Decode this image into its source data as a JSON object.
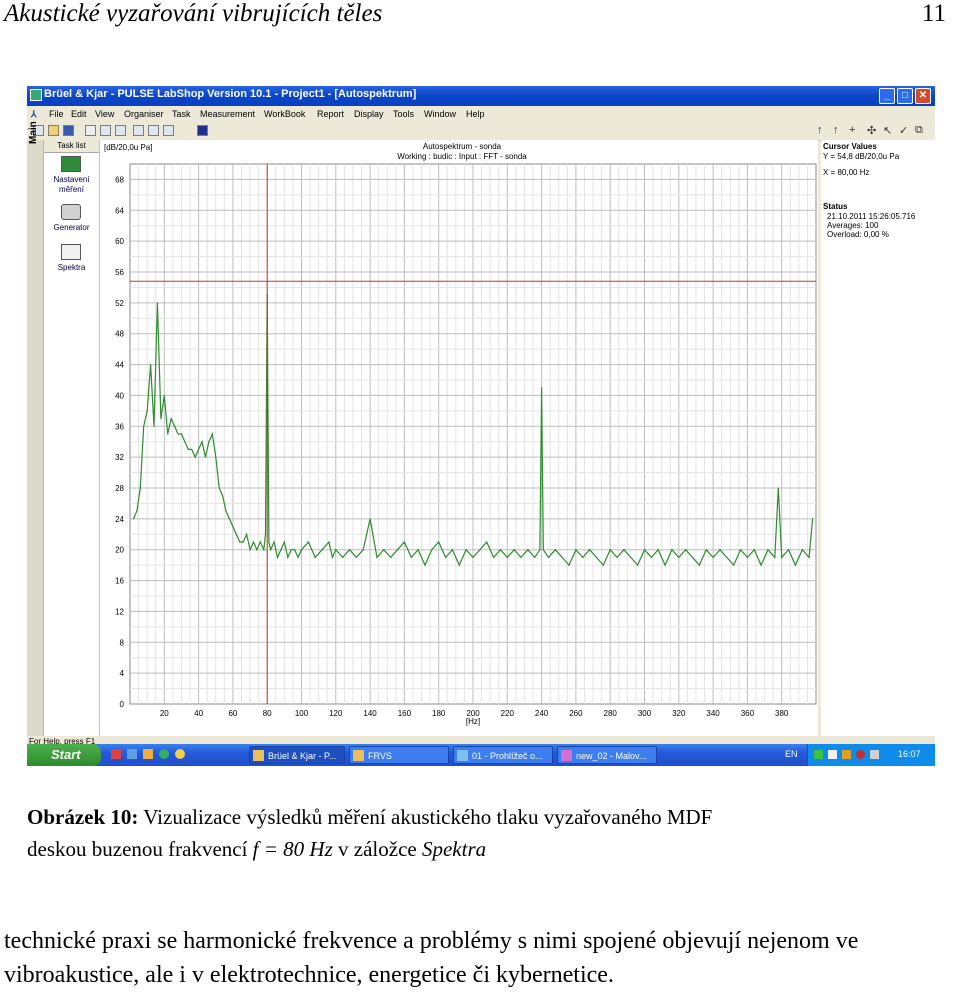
{
  "page": {
    "header_title": "Akustické vyzařování vibrujících těles",
    "page_number": "11"
  },
  "window": {
    "title": "Brüel & Kjar - PULSE LabShop Version 10.1 - Project1 - [Autospektrum]",
    "buttons": [
      "_",
      "□",
      "✕"
    ]
  },
  "menu": [
    "File",
    "Edit",
    "View",
    "Organiser",
    "Task",
    "Measurement",
    "WorkBook",
    "Report",
    "Display",
    "Tools",
    "Window",
    "Help"
  ],
  "sidebar": {
    "main_label": "Main",
    "task_list_header": "Task list",
    "items": [
      {
        "label_line1": "Nastavení",
        "label_line2": "měření"
      },
      {
        "label_line1": "Generator",
        "label_line2": ""
      },
      {
        "label_line1": "Spektra",
        "label_line2": ""
      }
    ]
  },
  "chart_header": {
    "unit_label": "[dB/20,0u Pa]",
    "title_line1": "Autospektrum - sonda",
    "title_line2": "Working : budic : Input : FFT - sonda"
  },
  "cursor_values": {
    "header": "Cursor Values",
    "y": "Y = 54,8 dB/20,0u Pa",
    "x": "X = 80,00 Hz",
    "status_header": "Status",
    "timestamp": "21.10.2011  15:26:05.716",
    "averages": "Averages: 100",
    "overload": "Overload:  0,00 %"
  },
  "chart_data": {
    "type": "line",
    "xlabel": "[Hz]",
    "ylabel": "[dB/20,0u Pa]",
    "xlim": [
      0,
      400
    ],
    "ylim": [
      0,
      70
    ],
    "x_ticks": [
      20,
      40,
      60,
      80,
      100,
      120,
      140,
      160,
      180,
      200,
      220,
      240,
      260,
      280,
      300,
      320,
      340,
      360,
      380
    ],
    "y_ticks": [
      0,
      4,
      8,
      12,
      16,
      20,
      24,
      28,
      32,
      36,
      40,
      44,
      48,
      52,
      56,
      60,
      64,
      68
    ],
    "grid": true,
    "cursor": {
      "x": 80,
      "y": 54.8
    },
    "series": [
      {
        "color": "#2e8b2e",
        "x": [
          2,
          4,
          6,
          8,
          10,
          12,
          14,
          16,
          18,
          20,
          22,
          24,
          26,
          28,
          30,
          32,
          34,
          36,
          38,
          40,
          42,
          44,
          46,
          48,
          50,
          52,
          54,
          56,
          58,
          60,
          62,
          64,
          66,
          68,
          70,
          72,
          74,
          76,
          78,
          79,
          80,
          81,
          82,
          84,
          86,
          88,
          90,
          92,
          94,
          96,
          98,
          100,
          104,
          108,
          112,
          116,
          118,
          120,
          124,
          128,
          132,
          136,
          140,
          144,
          148,
          152,
          156,
          160,
          164,
          168,
          172,
          176,
          180,
          184,
          188,
          192,
          196,
          200,
          204,
          208,
          212,
          216,
          220,
          224,
          228,
          232,
          236,
          239,
          240,
          241,
          244,
          248,
          252,
          256,
          260,
          264,
          268,
          272,
          276,
          280,
          284,
          288,
          292,
          296,
          300,
          304,
          308,
          312,
          316,
          320,
          324,
          328,
          332,
          336,
          340,
          344,
          348,
          352,
          356,
          360,
          364,
          368,
          372,
          376,
          378,
          380,
          384,
          388,
          392,
          396,
          398
        ],
        "y": [
          24,
          25,
          28,
          36,
          38,
          44,
          36,
          52,
          37,
          40,
          35,
          37,
          36,
          35,
          35,
          34,
          33,
          33,
          32,
          33,
          34,
          32,
          34,
          35,
          32,
          28,
          27,
          25,
          24,
          23,
          22,
          21,
          21,
          22,
          20,
          21,
          20,
          21,
          20,
          22,
          53,
          21,
          20,
          21,
          19,
          20,
          21,
          19,
          20,
          20,
          19,
          20,
          21,
          19,
          20,
          21,
          19,
          20,
          19,
          20,
          19,
          20,
          24,
          19,
          20,
          19,
          20,
          21,
          19,
          20,
          18,
          20,
          21,
          19,
          20,
          18,
          20,
          19,
          20,
          21,
          19,
          20,
          19,
          20,
          19,
          20,
          19,
          20,
          41,
          20,
          19,
          20,
          19,
          18,
          20,
          19,
          20,
          19,
          18,
          20,
          19,
          20,
          19,
          18,
          20,
          19,
          20,
          18,
          20,
          19,
          20,
          19,
          18,
          20,
          19,
          20,
          19,
          18,
          20,
          19,
          20,
          18,
          20,
          19,
          28,
          19,
          20,
          18,
          20,
          19,
          24
        ]
      }
    ]
  },
  "status_bar": {
    "help_text": "For Help, press F1"
  },
  "taskbar": {
    "start": "Start",
    "tasks": [
      "Brüel & Kjar - P...",
      "FRVS",
      "01 - Prohlížeč o...",
      "new_02 - Malov..."
    ],
    "lang": "EN",
    "clock": "16:07"
  },
  "caption": {
    "label": "Obrázek 10:",
    "line1": "Vizualizace výsledků měření akustického tlaku vyzařovaného MDF",
    "line2_prefix": "deskou buzenou frakvencí",
    "formula": "f = 80 Hz",
    "line2_mid": "v záložce",
    "line2_em": "Spektra"
  },
  "body_text": "technické praxi se harmonické frekvence a problémy s nimi spojené objevují nejenom ve vibroakustice, ale i v elektrotechnice, energetice či kybernetice."
}
